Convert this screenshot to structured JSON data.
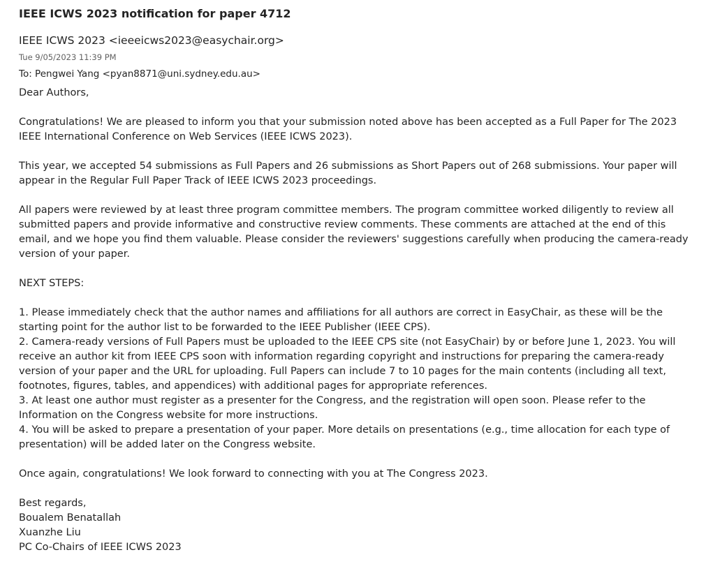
{
  "email": {
    "subject": "IEEE ICWS 2023 notification for paper 4712",
    "sender": "IEEE ICWS 2023 <ieeeicws2023@easychair.org>",
    "timestamp": "Tue 9/05/2023 11:39 PM",
    "recipient": "To: Pengwei Yang <pyan8871@uni.sydney.edu.au>",
    "body": {
      "greeting": "Dear Authors,",
      "para1": "Congratulations! We are pleased to inform you that your submission noted above has been accepted as a Full Paper for The 2023 IEEE International Conference on Web Services (IEEE ICWS 2023).",
      "para2": "This year, we accepted 54 submissions as Full Papers and 26 submissions as Short Papers out of 268 submissions. Your paper will appear in the Regular Full Paper Track of IEEE ICWS 2023 proceedings.",
      "para3": "All papers were reviewed by at least three program committee members. The program committee worked diligently to review all submitted papers and provide informative and constructive review comments. These comments are attached at the end of this email, and we hope you find them valuable. Please consider the reviewers' suggestions carefully when producing the camera-ready version of your paper.",
      "next_steps_heading": "NEXT STEPS:",
      "steps": [
        "1. Please immediately check that the author names and affiliations for all authors are correct in EasyChair, as these will be the starting point for the author list to be forwarded to the IEEE Publisher (IEEE CPS).",
        "2. Camera-ready versions of Full Papers must be uploaded to the IEEE CPS site (not EasyChair) by or before June 1, 2023. You will receive an author kit from IEEE CPS soon with information regarding copyright and instructions for preparing the camera-ready version of your paper and the URL for uploading. Full Papers can include 7 to 10 pages for the main contents (including all text, footnotes, figures, tables, and appendices) with additional pages for appropriate references.",
        "3. At least one author must register as a presenter for the Congress, and the registration will open soon. Please refer to the Information on the Congress website for more instructions.",
        "4. You will be asked to prepare a presentation of your paper. More details on presentations (e.g., time allocation for each type of presentation) will be added later on the Congress website."
      ],
      "closing": "Once again, congratulations! We look forward to connecting with you at The Congress 2023.",
      "signoff": "Best regards,",
      "signatures": [
        "Boualem Benatallah",
        "Xuanzhe Liu",
        "PC Co-Chairs of IEEE ICWS 2023"
      ]
    }
  }
}
